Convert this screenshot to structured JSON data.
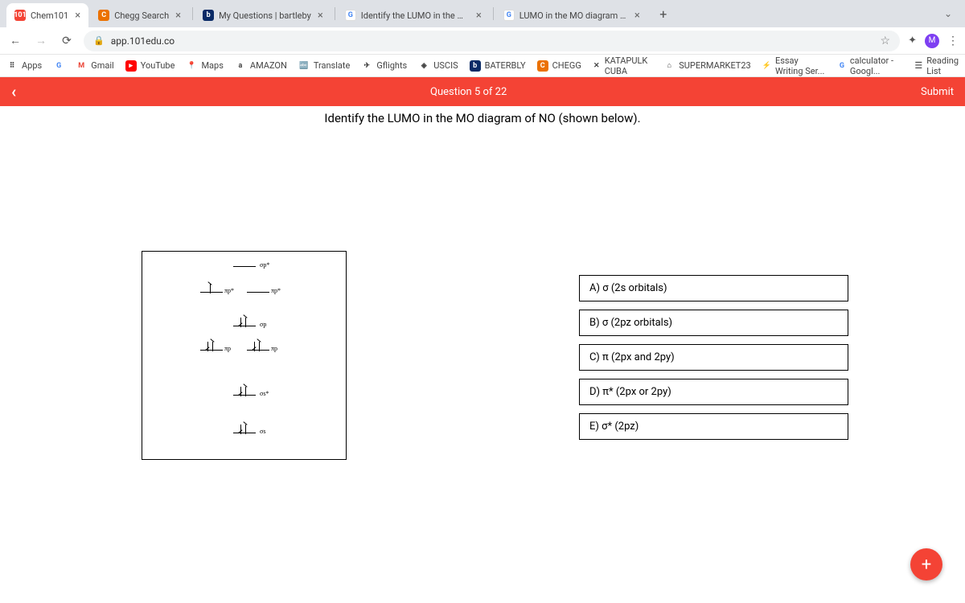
{
  "tabs": [
    {
      "label": "Chem101",
      "fav": "101",
      "favbg": "#f44335"
    },
    {
      "label": "Chegg Search",
      "fav": "C",
      "favbg": "#eb7100"
    },
    {
      "label": "My Questions | bartleby",
      "fav": "b",
      "favbg": "#0a2a66"
    },
    {
      "label": "Identify the LUMO in the MO d",
      "fav": "G",
      "favbg": "#fff"
    },
    {
      "label": "LUMO in the MO diagram of N",
      "fav": "G",
      "favbg": "#fff"
    }
  ],
  "url": "app.101edu.co",
  "bookmarks": [
    {
      "label": "Apps",
      "ic": "⠿",
      "bg": ""
    },
    {
      "label": "",
      "ic": "G",
      "bg": ""
    },
    {
      "label": "Gmail",
      "ic": "M",
      "bg": ""
    },
    {
      "label": "YouTube",
      "ic": "▸",
      "bg": "#f00"
    },
    {
      "label": "Maps",
      "ic": "📍",
      "bg": ""
    },
    {
      "label": "AMAZON",
      "ic": "a",
      "bg": ""
    },
    {
      "label": "Translate",
      "ic": "⠿",
      "bg": ""
    },
    {
      "label": "Gflights",
      "ic": "✈",
      "bg": ""
    },
    {
      "label": "USCIS",
      "ic": "◈",
      "bg": ""
    },
    {
      "label": "BATERBLY",
      "ic": "b",
      "bg": "#0a2a66"
    },
    {
      "label": "CHEGG",
      "ic": "C",
      "bg": "#eb7100"
    },
    {
      "label": "KATAPULK CUBA",
      "ic": "✕",
      "bg": ""
    },
    {
      "label": "SUPERMARKET23",
      "ic": "⌂",
      "bg": ""
    },
    {
      "label": "Essay Writing Ser...",
      "ic": "⚡",
      "bg": ""
    },
    {
      "label": "calculator - Googl...",
      "ic": "G",
      "bg": ""
    }
  ],
  "reading": "Reading List",
  "qbar": {
    "center": "Question 5 of 22",
    "submit": "Submit"
  },
  "prompt": "Identify the LUMO in the MO diagram of NO (shown below).",
  "mo": {
    "sigma_p_star": "σp*",
    "pi_p_star": "πp*",
    "sigma_p": "σp",
    "pi_p": "πp",
    "sigma_s_star": "σs*",
    "sigma_s": "σs"
  },
  "options": [
    "A) σ (2s orbitals)",
    "B) σ (2pz orbitals)",
    "C) π (2px and 2py)",
    "D) π* (2px or 2py)",
    "E) σ* (2pz)"
  ],
  "plus": "+"
}
